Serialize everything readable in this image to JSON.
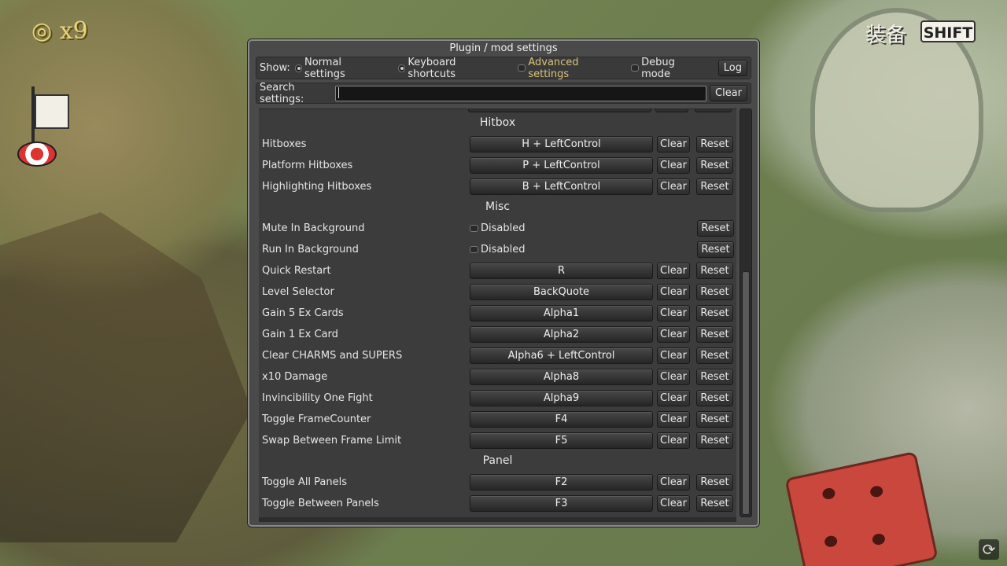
{
  "window": {
    "title": "Plugin / mod settings"
  },
  "show_bar": {
    "label": "Show:",
    "options": [
      {
        "label": "Normal settings",
        "type": "radio",
        "selected": false
      },
      {
        "label": "Keyboard shortcuts",
        "type": "radio",
        "selected": true
      },
      {
        "label": "Advanced settings",
        "type": "checkbox",
        "checked": false
      },
      {
        "label": "Debug mode",
        "type": "checkbox",
        "checked": false
      }
    ],
    "log_label": "Log"
  },
  "search": {
    "label": "Search settings:",
    "value": "",
    "clear_label": "Clear"
  },
  "sections": [
    {
      "title": "Hitbox"
    },
    {
      "title": "Misc"
    },
    {
      "title": "Panel"
    }
  ],
  "rows": [
    {
      "name": "Hitboxes",
      "key": "H + LeftControl"
    },
    {
      "name": "Platform Hitboxes",
      "key": "P + LeftControl"
    },
    {
      "name": "Highlighting Hitboxes",
      "key": "B + LeftControl"
    },
    {
      "name": "Mute In Background",
      "toggle": "Disabled"
    },
    {
      "name": "Run In Background",
      "toggle": "Disabled"
    },
    {
      "name": "Quick Restart",
      "key": "R"
    },
    {
      "name": "Level Selector",
      "key": "BackQuote"
    },
    {
      "name": "Gain 5 Ex Cards",
      "key": "Alpha1"
    },
    {
      "name": "Gain 1 Ex Card",
      "key": "Alpha2"
    },
    {
      "name": "Clear CHARMS and SUPERS",
      "key": "Alpha6 + LeftControl"
    },
    {
      "name": "x10 Damage",
      "key": "Alpha8"
    },
    {
      "name": "Invincibility One Fight",
      "key": "Alpha9"
    },
    {
      "name": "Toggle FrameCounter",
      "key": "F4"
    },
    {
      "name": "Swap Between Frame Limit",
      "key": "F5"
    },
    {
      "name": "Toggle All Panels",
      "key": "F2"
    },
    {
      "name": "Toggle Between Panels",
      "key": "F3"
    }
  ],
  "buttons": {
    "clear": "Clear",
    "reset": "Reset"
  },
  "hud": {
    "coin_count": "x9",
    "key_prompt": "SHIFT",
    "kanji": "装备"
  },
  "icons": [
    "coin-icon",
    "loading-icon",
    "radio-icon",
    "checkbox-icon"
  ]
}
